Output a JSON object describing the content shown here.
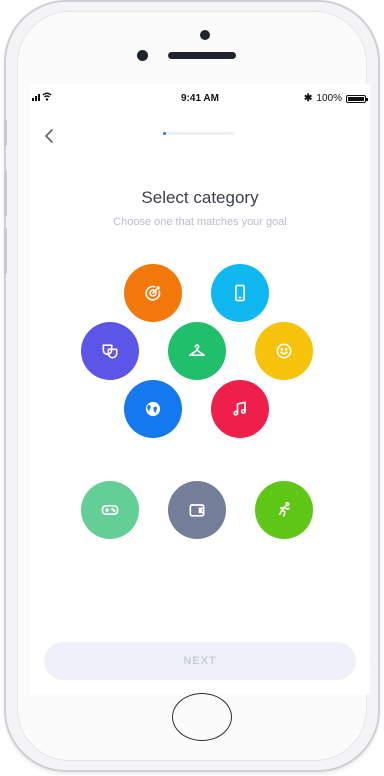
{
  "status_bar": {
    "time": "9:41 AM",
    "battery": "100%",
    "bluetooth_symbol": "✱"
  },
  "header": {
    "progress_fraction": 0.04
  },
  "main": {
    "title": "Select category",
    "subtitle": "Choose one that matches your goal"
  },
  "categories": [
    {
      "icon": "target-icon",
      "color": "#f2780c"
    },
    {
      "icon": "phone-icon",
      "color": "#10b8f2"
    },
    {
      "icon": "masks-icon",
      "color": "#5b55e8"
    },
    {
      "icon": "hanger-icon",
      "color": "#1fbf6c"
    },
    {
      "icon": "smiley-icon",
      "color": "#f7c20a"
    },
    {
      "icon": "globe-icon",
      "color": "#1479ee"
    },
    {
      "icon": "music-icon",
      "color": "#ef1f4b"
    },
    {
      "icon": "gamepad-icon",
      "color": "#63cf96"
    },
    {
      "icon": "wallet-icon",
      "color": "#737f98"
    },
    {
      "icon": "runner-icon",
      "color": "#5ec614"
    }
  ],
  "footer": {
    "next_label": "NEXT"
  }
}
